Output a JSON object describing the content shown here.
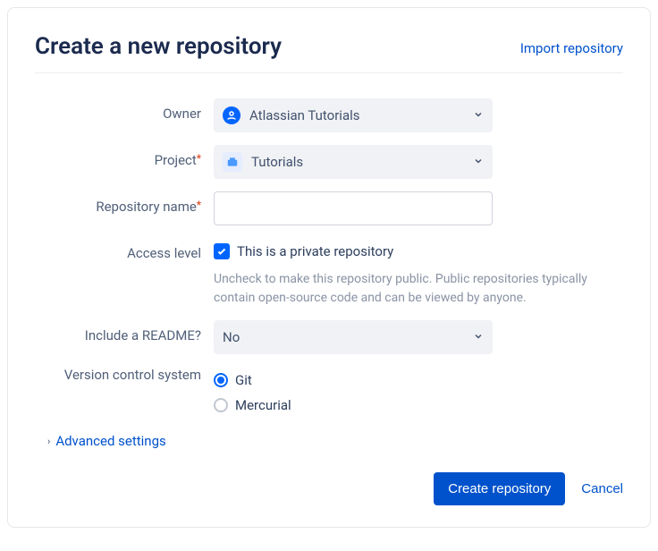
{
  "header": {
    "title": "Create a new repository",
    "import_link": "Import repository"
  },
  "form": {
    "owner": {
      "label": "Owner",
      "value": "Atlassian Tutorials",
      "icon": "owner-avatar-icon"
    },
    "project": {
      "label": "Project",
      "required": true,
      "value": "Tutorials",
      "icon": "project-avatar-icon"
    },
    "repo_name": {
      "label": "Repository name",
      "required": true,
      "value": ""
    },
    "access": {
      "label": "Access level",
      "checkbox_label": "This is a private repository",
      "checked": true,
      "help": "Uncheck to make this repository public. Public repositories typically contain open-source code and can be viewed by anyone."
    },
    "readme": {
      "label": "Include a README?",
      "value": "No"
    },
    "vcs": {
      "label": "Version control system",
      "options": {
        "git": "Git",
        "hg": "Mercurial"
      },
      "selected": "git"
    }
  },
  "advanced_label": "Advanced settings",
  "footer": {
    "submit": "Create repository",
    "cancel": "Cancel"
  }
}
